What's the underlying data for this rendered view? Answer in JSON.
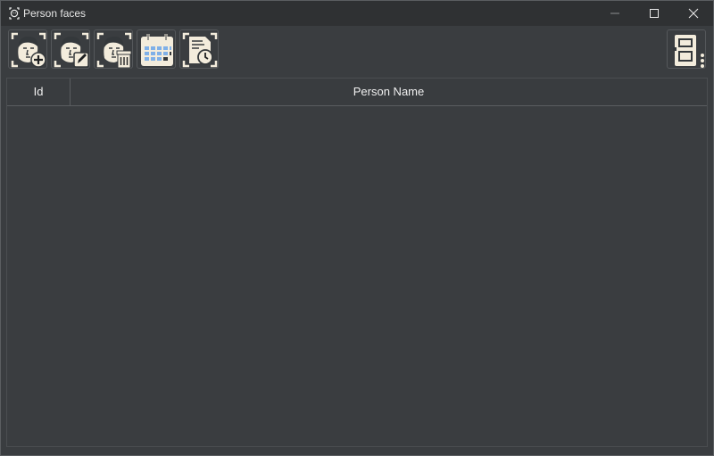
{
  "window": {
    "title": "Person faces"
  },
  "toolbar": {
    "buttons": [
      {
        "icon": "add-person-face-icon"
      },
      {
        "icon": "edit-person-face-icon"
      },
      {
        "icon": "delete-person-face-icon"
      },
      {
        "icon": "calendar-icon"
      },
      {
        "icon": "document-history-icon"
      }
    ],
    "right_button": {
      "icon": "layout-more-icon"
    }
  },
  "table": {
    "columns": [
      "Id",
      "Person Name"
    ],
    "rows": []
  },
  "colors": {
    "background": "#3a3d40",
    "titlebar": "#2f3133",
    "icon_light": "#f3ecdc",
    "calendar_accent": "#7fb0e8"
  }
}
